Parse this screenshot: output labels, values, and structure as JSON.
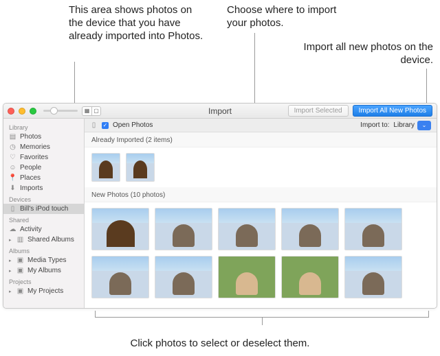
{
  "callouts": {
    "already_imported": "This area shows photos on the device that you have already imported into Photos.",
    "choose_where": "Choose where to import your photos.",
    "import_all": "Import all new photos on the device.",
    "select_deselect": "Click photos to select or deselect them."
  },
  "window": {
    "title": "Import",
    "buttons": {
      "import_selected": "Import Selected",
      "import_all_new": "Import All New Photos"
    }
  },
  "sidebar": {
    "groups": [
      {
        "header": "Library",
        "items": [
          {
            "icon": "photos-icon",
            "label": "Photos"
          },
          {
            "icon": "memories-icon",
            "label": "Memories"
          },
          {
            "icon": "favorites-icon",
            "label": "Favorites"
          },
          {
            "icon": "people-icon",
            "label": "People"
          },
          {
            "icon": "places-icon",
            "label": "Places"
          },
          {
            "icon": "imports-icon",
            "label": "Imports"
          }
        ]
      },
      {
        "header": "Devices",
        "items": [
          {
            "icon": "device-icon",
            "label": "Bill's iPod touch",
            "selected": true
          }
        ]
      },
      {
        "header": "Shared",
        "items": [
          {
            "icon": "activity-icon",
            "label": "Activity"
          },
          {
            "icon": "shared-albums-icon",
            "label": "Shared Albums",
            "disclosure": true
          }
        ]
      },
      {
        "header": "Albums",
        "items": [
          {
            "icon": "media-types-icon",
            "label": "Media Types",
            "disclosure": true
          },
          {
            "icon": "my-albums-icon",
            "label": "My Albums",
            "disclosure": true
          }
        ]
      },
      {
        "header": "Projects",
        "items": [
          {
            "icon": "my-projects-icon",
            "label": "My Projects",
            "disclosure": true
          }
        ]
      }
    ]
  },
  "importbar": {
    "open_photos_label": "Open Photos",
    "import_to_label": "Import to:",
    "import_to_value": "Library"
  },
  "sections": {
    "already": {
      "label": "Already Imported (2 items)",
      "count": 2
    },
    "new": {
      "label": "New Photos (10 photos)",
      "count": 10
    }
  }
}
